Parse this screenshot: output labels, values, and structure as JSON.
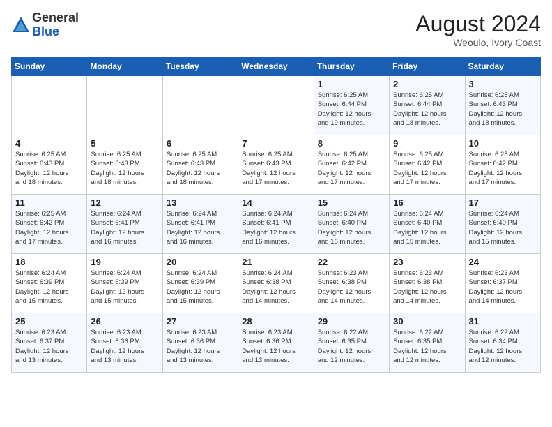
{
  "logo": {
    "general": "General",
    "blue": "Blue"
  },
  "title": {
    "month_year": "August 2024",
    "location": "Weoulo, Ivory Coast"
  },
  "days_of_week": [
    "Sunday",
    "Monday",
    "Tuesday",
    "Wednesday",
    "Thursday",
    "Friday",
    "Saturday"
  ],
  "weeks": [
    [
      {
        "day": "",
        "info": ""
      },
      {
        "day": "",
        "info": ""
      },
      {
        "day": "",
        "info": ""
      },
      {
        "day": "",
        "info": ""
      },
      {
        "day": "1",
        "info": "Sunrise: 6:25 AM\nSunset: 6:44 PM\nDaylight: 12 hours\nand 19 minutes."
      },
      {
        "day": "2",
        "info": "Sunrise: 6:25 AM\nSunset: 6:44 PM\nDaylight: 12 hours\nand 18 minutes."
      },
      {
        "day": "3",
        "info": "Sunrise: 6:25 AM\nSunset: 6:43 PM\nDaylight: 12 hours\nand 18 minutes."
      }
    ],
    [
      {
        "day": "4",
        "info": "Sunrise: 6:25 AM\nSunset: 6:43 PM\nDaylight: 12 hours\nand 18 minutes."
      },
      {
        "day": "5",
        "info": "Sunrise: 6:25 AM\nSunset: 6:43 PM\nDaylight: 12 hours\nand 18 minutes."
      },
      {
        "day": "6",
        "info": "Sunrise: 6:25 AM\nSunset: 6:43 PM\nDaylight: 12 hours\nand 18 minutes."
      },
      {
        "day": "7",
        "info": "Sunrise: 6:25 AM\nSunset: 6:43 PM\nDaylight: 12 hours\nand 17 minutes."
      },
      {
        "day": "8",
        "info": "Sunrise: 6:25 AM\nSunset: 6:42 PM\nDaylight: 12 hours\nand 17 minutes."
      },
      {
        "day": "9",
        "info": "Sunrise: 6:25 AM\nSunset: 6:42 PM\nDaylight: 12 hours\nand 17 minutes."
      },
      {
        "day": "10",
        "info": "Sunrise: 6:25 AM\nSunset: 6:42 PM\nDaylight: 12 hours\nand 17 minutes."
      }
    ],
    [
      {
        "day": "11",
        "info": "Sunrise: 6:25 AM\nSunset: 6:42 PM\nDaylight: 12 hours\nand 17 minutes."
      },
      {
        "day": "12",
        "info": "Sunrise: 6:24 AM\nSunset: 6:41 PM\nDaylight: 12 hours\nand 16 minutes."
      },
      {
        "day": "13",
        "info": "Sunrise: 6:24 AM\nSunset: 6:41 PM\nDaylight: 12 hours\nand 16 minutes."
      },
      {
        "day": "14",
        "info": "Sunrise: 6:24 AM\nSunset: 6:41 PM\nDaylight: 12 hours\nand 16 minutes."
      },
      {
        "day": "15",
        "info": "Sunrise: 6:24 AM\nSunset: 6:40 PM\nDaylight: 12 hours\nand 16 minutes."
      },
      {
        "day": "16",
        "info": "Sunrise: 6:24 AM\nSunset: 6:40 PM\nDaylight: 12 hours\nand 15 minutes."
      },
      {
        "day": "17",
        "info": "Sunrise: 6:24 AM\nSunset: 6:40 PM\nDaylight: 12 hours\nand 15 minutes."
      }
    ],
    [
      {
        "day": "18",
        "info": "Sunrise: 6:24 AM\nSunset: 6:39 PM\nDaylight: 12 hours\nand 15 minutes."
      },
      {
        "day": "19",
        "info": "Sunrise: 6:24 AM\nSunset: 6:39 PM\nDaylight: 12 hours\nand 15 minutes."
      },
      {
        "day": "20",
        "info": "Sunrise: 6:24 AM\nSunset: 6:39 PM\nDaylight: 12 hours\nand 15 minutes."
      },
      {
        "day": "21",
        "info": "Sunrise: 6:24 AM\nSunset: 6:38 PM\nDaylight: 12 hours\nand 14 minutes."
      },
      {
        "day": "22",
        "info": "Sunrise: 6:23 AM\nSunset: 6:38 PM\nDaylight: 12 hours\nand 14 minutes."
      },
      {
        "day": "23",
        "info": "Sunrise: 6:23 AM\nSunset: 6:38 PM\nDaylight: 12 hours\nand 14 minutes."
      },
      {
        "day": "24",
        "info": "Sunrise: 6:23 AM\nSunset: 6:37 PM\nDaylight: 12 hours\nand 14 minutes."
      }
    ],
    [
      {
        "day": "25",
        "info": "Sunrise: 6:23 AM\nSunset: 6:37 PM\nDaylight: 12 hours\nand 13 minutes."
      },
      {
        "day": "26",
        "info": "Sunrise: 6:23 AM\nSunset: 6:36 PM\nDaylight: 12 hours\nand 13 minutes."
      },
      {
        "day": "27",
        "info": "Sunrise: 6:23 AM\nSunset: 6:36 PM\nDaylight: 12 hours\nand 13 minutes."
      },
      {
        "day": "28",
        "info": "Sunrise: 6:23 AM\nSunset: 6:36 PM\nDaylight: 12 hours\nand 13 minutes."
      },
      {
        "day": "29",
        "info": "Sunrise: 6:22 AM\nSunset: 6:35 PM\nDaylight: 12 hours\nand 12 minutes."
      },
      {
        "day": "30",
        "info": "Sunrise: 6:22 AM\nSunset: 6:35 PM\nDaylight: 12 hours\nand 12 minutes."
      },
      {
        "day": "31",
        "info": "Sunrise: 6:22 AM\nSunset: 6:34 PM\nDaylight: 12 hours\nand 12 minutes."
      }
    ]
  ]
}
